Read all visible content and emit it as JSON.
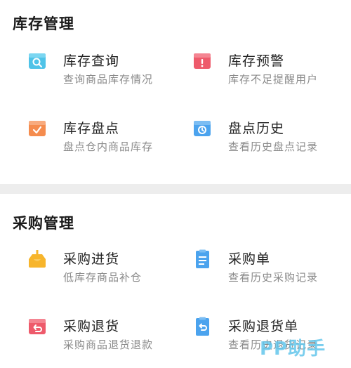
{
  "inventory": {
    "title": "库存管理",
    "items": [
      {
        "label": "库存查询",
        "desc": "查询商品库存情况",
        "icon": "inventory-search-icon",
        "color": "#4fc3e8"
      },
      {
        "label": "库存预警",
        "desc": "库存不足提醒用户",
        "icon": "inventory-warning-icon",
        "color": "#ee5a6b"
      },
      {
        "label": "库存盘点",
        "desc": "盘点仓内商品库存",
        "icon": "inventory-check-icon",
        "color": "#f58c4e"
      },
      {
        "label": "盘点历史",
        "desc": "查看历史盘点记录",
        "icon": "check-history-icon",
        "color": "#4ba3ee"
      }
    ]
  },
  "purchase": {
    "title": "采购管理",
    "items": [
      {
        "label": "采购进货",
        "desc": "低库存商品补仓",
        "icon": "purchase-stock-icon",
        "color": "#f7b52c"
      },
      {
        "label": "采购单",
        "desc": "查看历史采购记录",
        "icon": "purchase-order-icon",
        "color": "#4ba3ee"
      },
      {
        "label": "采购退货",
        "desc": "采购商品退货退款",
        "icon": "purchase-return-icon",
        "color": "#ee5a6b"
      },
      {
        "label": "采购退货单",
        "desc": "查看历史退货记录",
        "icon": "return-order-icon",
        "color": "#4ba3ee"
      }
    ]
  },
  "watermark": "PP助手"
}
